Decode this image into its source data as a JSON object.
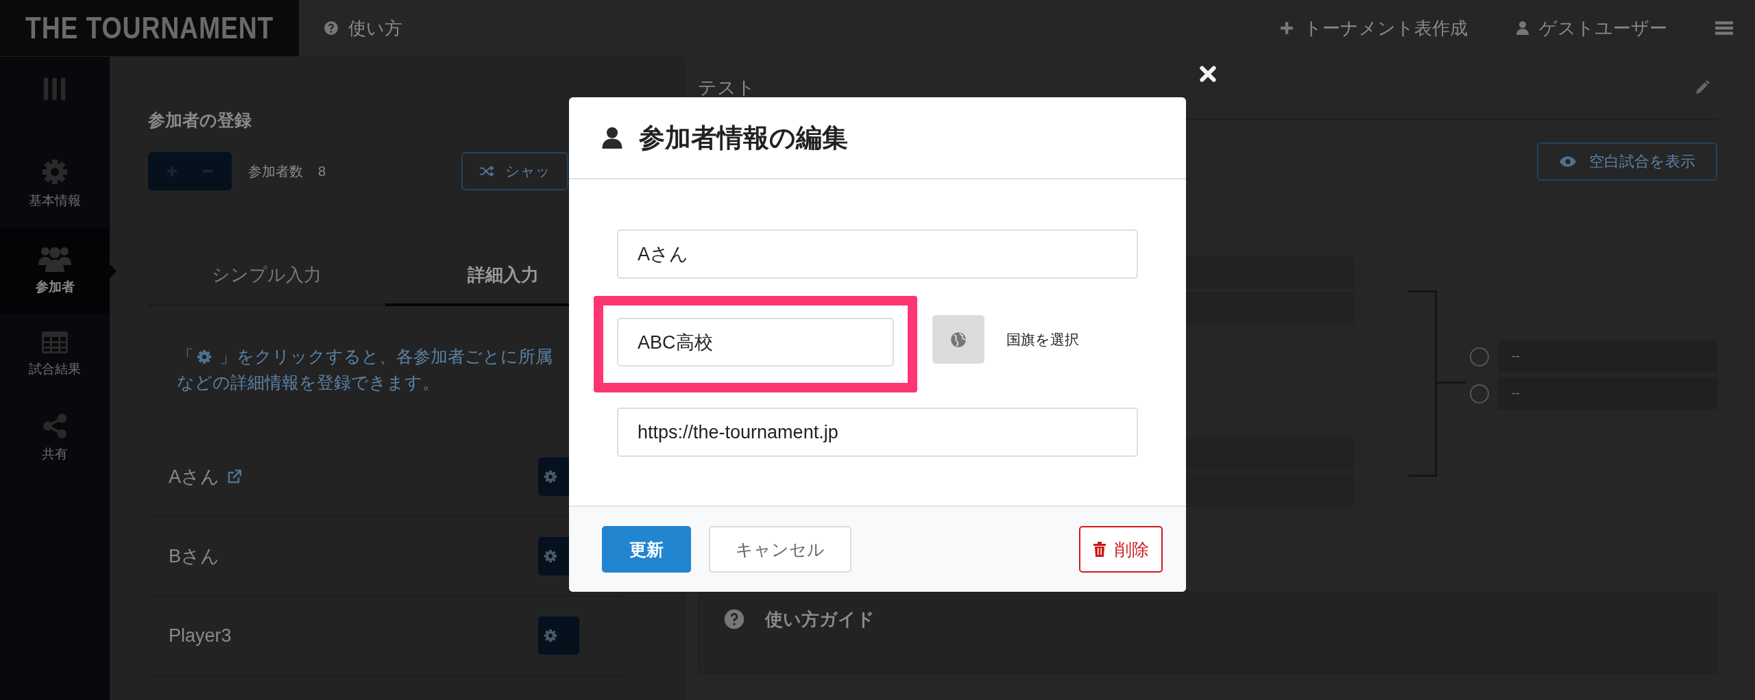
{
  "header": {
    "logo": "THE TOURNAMENT",
    "help": "使い方",
    "create": "トーナメント表作成",
    "user": "ゲストユーザー"
  },
  "sidebar": {
    "items": [
      {
        "kind": "gear",
        "label": "基本情報",
        "selected": false
      },
      {
        "kind": "users",
        "label": "参加者",
        "selected": true
      },
      {
        "kind": "table",
        "label": "試合結果",
        "selected": false
      },
      {
        "kind": "share",
        "label": "共有",
        "selected": false
      }
    ]
  },
  "registration": {
    "title": "参加者の登録",
    "count_label": "参加者数",
    "count": "8",
    "shuffle": "シャッ",
    "tabs": [
      {
        "label": "シンプル入力",
        "selected": false
      },
      {
        "label": "詳細入力",
        "selected": true
      }
    ],
    "info_open": "「",
    "info_rest": " 」をクリックすると、各参加者ごとに所属などの詳細情報を登録できます。",
    "participants": [
      {
        "name": "Aさん",
        "link": true
      },
      {
        "name": "Bさん",
        "link": false
      },
      {
        "name": "Player3",
        "link": false
      }
    ]
  },
  "tournament": {
    "title": "テスト",
    "show_blank": "空白試合を表示",
    "final": [
      {
        "name": "--",
        "selected": false
      },
      {
        "name": "--",
        "selected": false
      }
    ],
    "guide": "使い方ガイド"
  },
  "modal": {
    "title": "参加者情報の編集",
    "name": "Aさん",
    "affiliation": "ABC高校",
    "flag_label": "国旗を選択",
    "url": "https://the-tournament.jp",
    "update": "更新",
    "cancel": "キャンセル",
    "delete": "削除"
  }
}
